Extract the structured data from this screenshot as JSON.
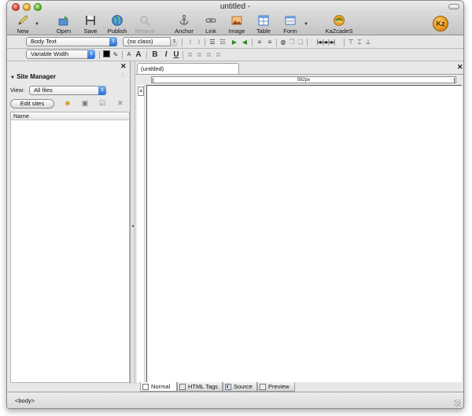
{
  "window": {
    "title": "untitled -"
  },
  "toolbar": {
    "buttons": [
      {
        "label": "New",
        "icon": "pencil-icon"
      },
      {
        "label": "Open",
        "icon": "open-folder-icon"
      },
      {
        "label": "Save",
        "icon": "floppy-disk-icon"
      },
      {
        "label": "Publish",
        "icon": "globe-icon"
      },
      {
        "label": "Browse",
        "icon": "magnifier-icon"
      },
      {
        "label": "Anchor",
        "icon": "anchor-icon"
      },
      {
        "label": "Link",
        "icon": "chain-link-icon"
      },
      {
        "label": "Image",
        "icon": "image-icon"
      },
      {
        "label": "Table",
        "icon": "table-icon"
      },
      {
        "label": "Form",
        "icon": "form-icon"
      },
      {
        "label": "KaZcadeS",
        "icon": "kazcades-css-icon"
      }
    ],
    "logo": "Kz"
  },
  "format": {
    "paragraph_style": "Body Text",
    "class": "(no class)",
    "font": "Variable Width",
    "b": "B",
    "i": "I",
    "u": "U",
    "font_smaller": "A",
    "font_larger": "A"
  },
  "site_manager": {
    "title": "Site Manager",
    "view_label": "View:",
    "view_value": "All files",
    "edit_sites": "Edit sites",
    "column_name": "Name"
  },
  "editor": {
    "tab": "(untitled)",
    "ruler": "592px",
    "vruler_mark": "a"
  },
  "modes": [
    "Normal",
    "HTML Tags",
    "Source",
    "Preview"
  ],
  "status": {
    "path": "<body>"
  },
  "colors": {
    "select_accent": "#2a6fd0",
    "window_bg": "#e8e8e8"
  }
}
